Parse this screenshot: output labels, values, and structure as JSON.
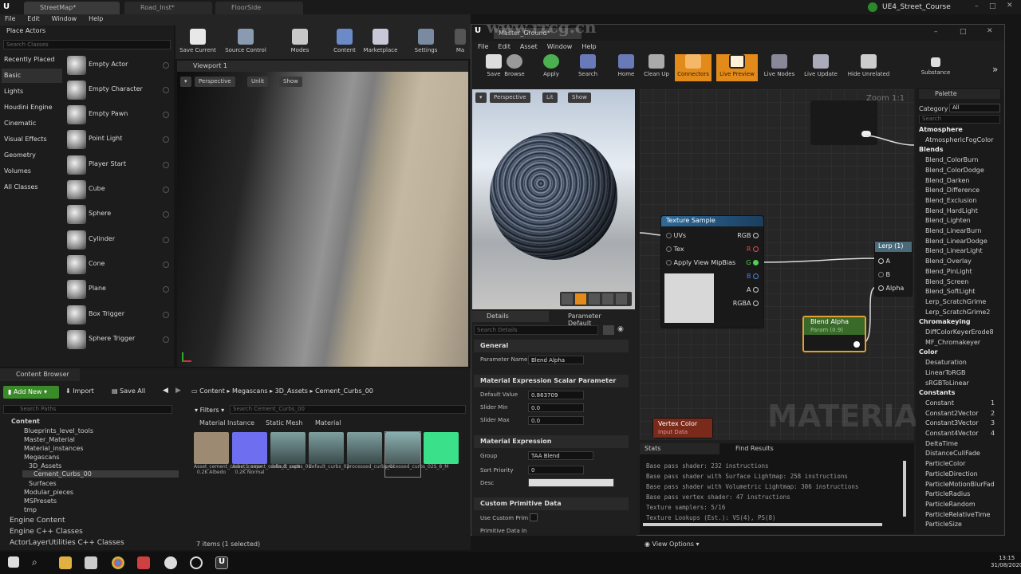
{
  "title_tabs": [
    "StreetMap*",
    "Road_Inst*",
    "FloorSide"
  ],
  "project_name": "UE4_Street_Course",
  "menu": [
    "File",
    "Edit",
    "Window",
    "Help"
  ],
  "place_actors": {
    "title": "Place Actors",
    "search_placeholder": "Search Classes",
    "categories": [
      "Recently Placed",
      "Basic",
      "Lights",
      "Houdini Engine",
      "Cinematic",
      "Visual Effects",
      "Geometry",
      "Volumes",
      "All Classes"
    ],
    "actors": [
      "Empty Actor",
      "Empty Character",
      "Empty Pawn",
      "Point Light",
      "Player Start",
      "Cube",
      "Sphere",
      "Cylinder",
      "Cone",
      "Plane",
      "Box Trigger",
      "Sphere Trigger"
    ]
  },
  "level_toolbar": [
    "Save Current",
    "Source Control",
    "Modes",
    "Content",
    "Marketplace",
    "Settings",
    "Ma"
  ],
  "viewport": {
    "title": "Viewport 1",
    "buttons": [
      "Perspective",
      "Unlit",
      "Show"
    ]
  },
  "material_editor": {
    "tab": "Master_Ground*",
    "menu": [
      "File",
      "Edit",
      "Asset",
      "Window",
      "Help"
    ],
    "toolbar": [
      "Save",
      "Browse",
      "Apply",
      "Search",
      "Home",
      "Clean Up",
      "Connectors",
      "Live Preview",
      "Live Nodes",
      "Live Update",
      "Hide Unrelated",
      "Substance"
    ],
    "preview_buttons": [
      "Perspective",
      "Lit",
      "Show"
    ],
    "zoom": "Zoom 1:1"
  },
  "nodes": {
    "texture_sample": {
      "title": "Texture Sample",
      "inputs": [
        "UVs",
        "Tex",
        "Apply View MipBias"
      ],
      "outputs": [
        "RGB",
        "R",
        "G",
        "B",
        "A",
        "RGBA"
      ]
    },
    "lerp": {
      "title": "Lerp (1)",
      "pins": [
        "A",
        "B",
        "Alpha"
      ]
    },
    "blend_alpha": {
      "title": "Blend Alpha",
      "sub": "Param (0.9)"
    },
    "vertex_color": {
      "title": "Vertex Color",
      "sub": "Input Data"
    }
  },
  "watermark_text": "MATERIAL",
  "details": {
    "tabs": [
      "Details",
      "Parameter Default"
    ],
    "search_placeholder": "Search Details",
    "sections": [
      "General",
      "Material Expression Scalar Parameter",
      "Material Expression",
      "Custom Primitive Data"
    ],
    "param_name_label": "Parameter Name",
    "param_name": "Blend Alpha",
    "default_value_label": "Default Value",
    "default_value": "0.863709",
    "slider_min_label": "Slider Min",
    "slider_min": "0.0",
    "slider_max_label": "Slider Max",
    "slider_max": "0.0",
    "group_label": "Group",
    "group": "TAA Blend",
    "sort_priority_label": "Sort Priority",
    "sort_priority": "0",
    "desc_label": "Desc",
    "use_custom_label": "Use Custom Prim",
    "prim_data_label": "Primitive Data In"
  },
  "stats": {
    "tabs": [
      "Stats",
      "Find Results"
    ],
    "lines": [
      "Base pass shader: 232 instructions",
      "Base pass shader with Surface Lightmap: 258 instructions",
      "Base pass shader with Volumetric Lightmap: 306 instructions",
      "Base pass vertex shader: 47 instructions",
      "Texture samplers: 5/16",
      "Texture Lookups (Est.): VS(4), PS(8)"
    ],
    "view_options": "View Options"
  },
  "palette": {
    "title": "Palette",
    "category_label": "Category",
    "category_value": "All",
    "search_placeholder": "Search",
    "entries": [
      {
        "h": "Atmosphere"
      },
      {
        "i": "AtmosphericFogColor"
      },
      {
        "h": "Blends"
      },
      {
        "i": "Blend_ColorBurn"
      },
      {
        "i": "Blend_ColorDodge"
      },
      {
        "i": "Blend_Darken"
      },
      {
        "i": "Blend_Difference"
      },
      {
        "i": "Blend_Exclusion"
      },
      {
        "i": "Blend_HardLight"
      },
      {
        "i": "Blend_Lighten"
      },
      {
        "i": "Blend_LinearBurn"
      },
      {
        "i": "Blend_LinearDodge"
      },
      {
        "i": "Blend_LinearLight"
      },
      {
        "i": "Blend_Overlay"
      },
      {
        "i": "Blend_PinLight"
      },
      {
        "i": "Blend_Screen"
      },
      {
        "i": "Blend_SoftLight"
      },
      {
        "i": "Lerp_ScratchGrime"
      },
      {
        "i": "Lerp_ScratchGrime2"
      },
      {
        "h": "Chromakeying"
      },
      {
        "i": "DiffColorKeyerErode8"
      },
      {
        "i": "MF_Chromakeyer"
      },
      {
        "h": "Color"
      },
      {
        "i": "Desaturation"
      },
      {
        "i": "LinearToRGB"
      },
      {
        "i": "sRGBToLinear"
      },
      {
        "h": "Constants"
      },
      {
        "i": "Constant",
        "n": "1"
      },
      {
        "i": "Constant2Vector",
        "n": "2"
      },
      {
        "i": "Constant3Vector",
        "n": "3"
      },
      {
        "i": "Constant4Vector",
        "n": "4"
      },
      {
        "i": "DeltaTime"
      },
      {
        "i": "DistanceCullFade"
      },
      {
        "i": "ParticleColor"
      },
      {
        "i": "ParticleDirection"
      },
      {
        "i": "ParticleMotionBlurFad"
      },
      {
        "i": "ParticleRadius"
      },
      {
        "i": "ParticleRandom"
      },
      {
        "i": "ParticleRelativeTime"
      },
      {
        "i": "ParticleSize"
      }
    ]
  },
  "content_browser": {
    "title": "Content Browser",
    "add_new": "Add New",
    "import": "Import",
    "save_all": "Save All",
    "path": [
      "Content",
      "Megascans",
      "3D_Assets",
      "Cement_Curbs_00"
    ],
    "filters": "Filters",
    "search_placeholder": "Search Cement_Curbs_00",
    "search_paths_placeholder": "Search Paths",
    "type_filters": [
      "Material Instance",
      "Static Mesh",
      "Material"
    ],
    "tree": [
      "Content",
      "Blueprints_level_tools",
      "Master_Material",
      "Material_instances",
      "Megascans",
      "3D_Assets",
      "Cement_Curbs_00",
      "Surfaces",
      "Modular_pieces",
      "MSPresets",
      "tmp"
    ],
    "bottom_tree": [
      "Engine Content",
      "Engine C++ Classes",
      "ActorLayerUtilities C++ Classes"
    ],
    "assets": [
      {
        "name": "Asset_cement_curbs_S_sepx 0.2K Albedo",
        "color": "#9c8a72"
      },
      {
        "name": "Asset_cement_curbs_S_sepx 0.2K Normal",
        "color": "#6d6ef0"
      },
      {
        "name": "default_curbs_01",
        "color": "#7fa0a0"
      },
      {
        "name": "default_curbs_02",
        "color": "#7fa0a0"
      },
      {
        "name": "processed_curbs_01",
        "color": "#7fa0a0"
      },
      {
        "name": "processed_curbs_02",
        "color": "#7fa0a0"
      },
      {
        "name": "S_8_M",
        "color": "#3ae08a"
      }
    ],
    "status": "7 items (1 selected)"
  },
  "clock": {
    "time": "13:15",
    "date": "31/08/2020"
  },
  "watermark": "www.rrcg.cn"
}
